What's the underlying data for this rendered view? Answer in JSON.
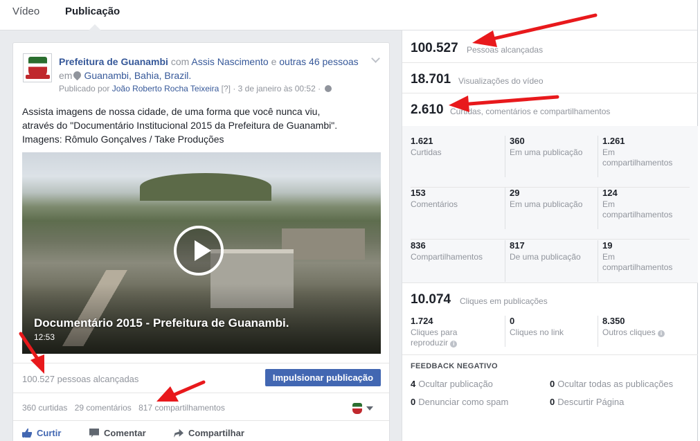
{
  "tabs": [
    {
      "label": "Vídeo"
    },
    {
      "label": "Publicação"
    }
  ],
  "post": {
    "page_name": "Prefeitura de Guanambi",
    "with_text": "com",
    "with_person": "Assis Nascimento",
    "and_text": "e",
    "others": "outras 46 pessoas",
    "in_text": "em",
    "location": "Guanambi, Bahia, Brazil.",
    "published_by_prefix": "Publicado por",
    "published_by": "João Roberto Rocha Teixeira",
    "help_mark": "[?]",
    "date_sep": "·",
    "date": "3 de janeiro às 00:52",
    "text_lines": [
      "Assista imagens de nossa cidade, de uma forma que você nunca viu,",
      "através do \"Documentário Institucional 2015 da Prefeitura de Guanambi\".",
      "Imagens: Rômulo Gonçalves / Take Produções"
    ],
    "video_title": "Documentário 2015 - Prefeitura de Guanambi.",
    "video_duration": "12:53",
    "reach": "100.527 pessoas alcançadas",
    "boost_label": "Impulsionar publicação",
    "likes": "360 curtidas",
    "comments": "29 comentários",
    "shares": "817 compartilhamentos",
    "actions": {
      "like": "Curtir",
      "comment": "Comentar",
      "share": "Compartilhar"
    }
  },
  "stats": {
    "reach": {
      "value": "100.527",
      "label": "Pessoas alcançadas"
    },
    "views": {
      "value": "18.701",
      "label": "Visualizações do vídeo"
    },
    "engagement": {
      "value": "2.610",
      "label": "Curtidas, comentários e compartilhamentos"
    },
    "breakdown": [
      [
        {
          "value": "1.621",
          "label": "Curtidas"
        },
        {
          "value": "360",
          "label": "Em uma publicação"
        },
        {
          "value": "1.261",
          "label": "Em compartilhamentos"
        }
      ],
      [
        {
          "value": "153",
          "label": "Comentários"
        },
        {
          "value": "29",
          "label": "Em uma publicação"
        },
        {
          "value": "124",
          "label": "Em compartilhamentos"
        }
      ],
      [
        {
          "value": "836",
          "label": "Compartilhamentos"
        },
        {
          "value": "817",
          "label": "De uma publicação"
        },
        {
          "value": "19",
          "label": "Em compartilhamentos"
        }
      ]
    ],
    "clicks": {
      "value": "10.074",
      "label": "Cliques em publicações",
      "items": [
        {
          "value": "1.724",
          "label": "Cliques para reproduzir"
        },
        {
          "value": "0",
          "label": "Cliques no link"
        },
        {
          "value": "8.350",
          "label": "Outros cliques"
        }
      ]
    },
    "negative": {
      "title": "FEEDBACK NEGATIVO",
      "items": [
        {
          "value": "4",
          "label": "Ocultar publicação"
        },
        {
          "value": "0",
          "label": "Ocultar todas as publicações"
        },
        {
          "value": "0",
          "label": "Denunciar como spam"
        },
        {
          "value": "0",
          "label": "Descurtir Página"
        }
      ]
    }
  },
  "colors": {
    "annotation_arrow": "#e8191c",
    "link": "#365899",
    "button": "#4267b2"
  }
}
